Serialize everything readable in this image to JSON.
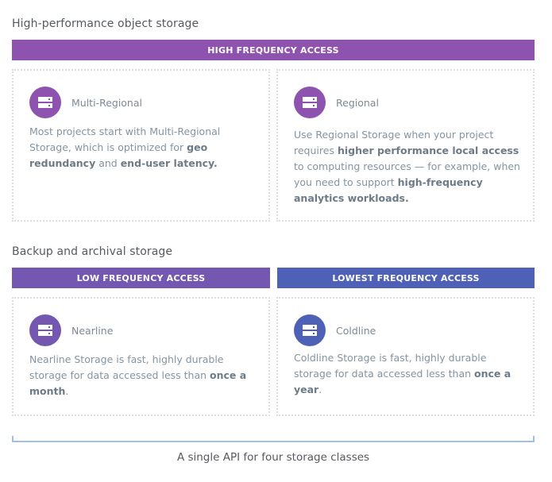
{
  "sections": {
    "high_performance": {
      "title": "High-performance object storage",
      "banner": "HIGH FREQUENCY ACCESS",
      "banner_color": "#8e53ae"
    },
    "backup": {
      "title": "Backup and archival storage",
      "banner_low": "LOW FREQUENCY ACCESS",
      "banner_low_color": "#7357b0",
      "banner_lowest": "LOWEST FREQUENCY ACCESS",
      "banner_lowest_color": "#4f61b7"
    }
  },
  "cards": {
    "multi_regional": {
      "icon": "storage-server-icon",
      "icon_color": "#8e53ae",
      "title": "Multi-Regional",
      "body": {
        "t1": "Most projects start with Multi-Regional Storage, which is optimized for ",
        "b1": "geo redundancy",
        "t2": " and ",
        "b2": "end-user latency."
      }
    },
    "regional": {
      "icon": "storage-server-icon",
      "icon_color": "#8e53ae",
      "title": "Regional",
      "body": {
        "t1": "Use Regional Storage when your project requires ",
        "b1": "higher performance local access",
        "t2": " to computing resources — for example, when you need to support ",
        "b2": "high-frequency analytics workloads."
      }
    },
    "nearline": {
      "icon": "storage-server-icon",
      "icon_color": "#7357b0",
      "title": "Nearline",
      "body": {
        "t1": "Nearline Storage is fast, highly durable storage for data accessed less than ",
        "b1": "once a month",
        "t2": "."
      }
    },
    "coldline": {
      "icon": "storage-server-icon",
      "icon_color": "#4f61b7",
      "title": "Coldline",
      "body": {
        "t1": "Coldline Storage is fast, highly durable storage for data accessed less than ",
        "b1": "once a year",
        "t2": "."
      }
    }
  },
  "footer": {
    "caption": "A single API for four storage classes",
    "bracket_color": "#a0c0ea"
  }
}
